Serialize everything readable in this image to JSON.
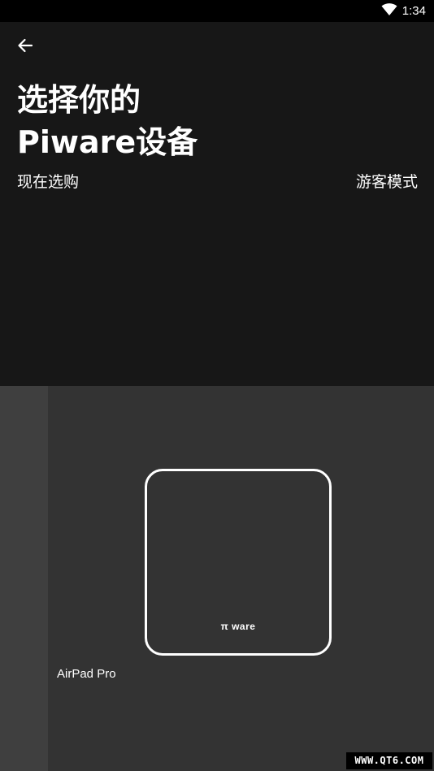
{
  "status_bar": {
    "time": "1:34",
    "icons": [
      "wifi-icon"
    ]
  },
  "header": {
    "back_icon": "arrow-left-icon",
    "title_line1": "选择你的",
    "title_line2": "Piware设备",
    "buy_now_label": "现在选购",
    "guest_mode_label": "游客模式"
  },
  "devices": [
    {
      "name": "AirPad Pro",
      "logo_text": "π ware"
    }
  ],
  "watermark": "WWW.QT6.COM",
  "colors": {
    "header_bg": "#171717",
    "device_area_bg": "#333333",
    "peek_card_bg": "#3f3f3f",
    "text": "#ffffff"
  }
}
